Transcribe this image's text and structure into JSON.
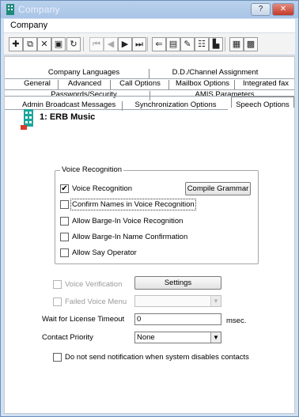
{
  "window": {
    "title": "Company"
  },
  "menu": {
    "items": [
      "Company"
    ]
  },
  "toolbar": {
    "buttons": [
      {
        "icon": "add-icon",
        "glyph": "✚"
      },
      {
        "icon": "copy-icon",
        "glyph": "⧉"
      },
      {
        "icon": "delete-icon",
        "glyph": "✕"
      },
      {
        "icon": "save-icon",
        "glyph": "▣"
      },
      {
        "icon": "refresh-icon",
        "glyph": "↻"
      },
      {
        "icon": "first-record-icon",
        "glyph": "⏮"
      },
      {
        "icon": "previous-record-icon",
        "glyph": "◀"
      },
      {
        "icon": "next-record-icon",
        "glyph": "▶"
      },
      {
        "icon": "last-record-icon",
        "glyph": "⏭"
      },
      {
        "icon": "find-icon",
        "glyph": "⇐"
      },
      {
        "icon": "filter-icon",
        "glyph": "▤"
      },
      {
        "icon": "edit-icon",
        "glyph": "✎"
      },
      {
        "icon": "properties-icon",
        "glyph": "☷"
      },
      {
        "icon": "chart-icon",
        "glyph": "▙"
      },
      {
        "icon": "report-icon",
        "glyph": "▦"
      },
      {
        "icon": "grid-icon",
        "glyph": "▩"
      }
    ]
  },
  "tabs": {
    "row1": [
      "Company Languages",
      "D.D./Channel Assignment"
    ],
    "row2": [
      "General",
      "Advanced",
      "Call Options",
      "Mailbox Options",
      "Integrated fax"
    ],
    "row3": [
      "Passwords/Security",
      "AMIS Parameters"
    ],
    "row4": [
      "Admin Broadcast Messages",
      "Synchronization Options",
      "Speech Options"
    ]
  },
  "record": {
    "title": "1: ERB Music"
  },
  "voice_recognition": {
    "legend": "Voice Recognition",
    "options": [
      {
        "label": "Voice Recognition",
        "checked": true
      },
      {
        "label": "Confirm Names in Voice Recognition",
        "checked": false
      },
      {
        "label": "Allow Barge-In Voice Recognition",
        "checked": false
      },
      {
        "label": "Allow Barge-In Name Confirmation",
        "checked": false
      },
      {
        "label": "Allow Say Operator",
        "checked": false
      }
    ],
    "compile_label": "Compile Grammar"
  },
  "voice_verification": {
    "label": "Voice Verification",
    "checked": false,
    "settings_label": "Settings"
  },
  "failed_voice_menu": {
    "label": "Failed Voice Menu",
    "checked": false,
    "value": ""
  },
  "license_timeout": {
    "label": "Wait for License Timeout",
    "value": "0",
    "unit": "msec."
  },
  "contact_priority": {
    "label": "Contact Priority",
    "value": "None"
  },
  "notification": {
    "label": "Do not send notification when system disables contacts",
    "checked": false
  },
  "colors": {
    "titlebar": "#b9d1ec",
    "close": "#c3392a",
    "frame": "#cfe0f3"
  }
}
